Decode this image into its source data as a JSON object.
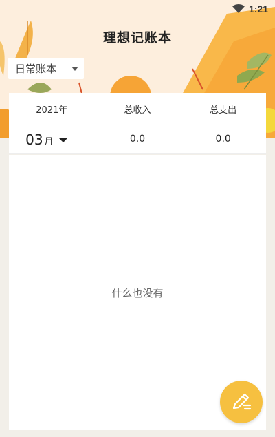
{
  "status_bar": {
    "time": "1:21",
    "wifi_icon": "wifi-icon"
  },
  "app": {
    "title": "理想记账本"
  },
  "account_selector": {
    "selected": "日常账本"
  },
  "summary": {
    "year": "2021年",
    "month_number": "03",
    "month_unit": "月",
    "income_label": "总收入",
    "income_value": "0.0",
    "expense_label": "总支出",
    "expense_value": "0.0"
  },
  "list": {
    "empty_text": "什么也没有"
  },
  "fab": {
    "icon": "pencil-icon"
  },
  "colors": {
    "accent": "#f6c040",
    "header_orange": "#f7a93a",
    "background": "#f2efe9"
  }
}
